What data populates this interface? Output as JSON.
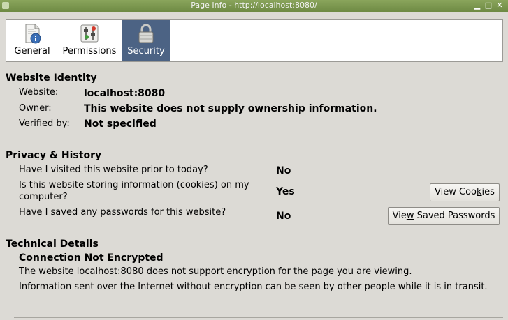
{
  "window": {
    "title": "Page Info - http://localhost:8080/",
    "min_symbol": "▁",
    "max_symbol": "□",
    "close_symbol": "✕"
  },
  "tabs": [
    {
      "label": "General",
      "icon": "page-info-icon",
      "selected": false
    },
    {
      "label": "Permissions",
      "icon": "permissions-icon",
      "selected": false
    },
    {
      "label": "Security",
      "icon": "padlock-icon",
      "selected": true
    }
  ],
  "identity": {
    "heading": "Website Identity",
    "website_label": "Website:",
    "website_value": "localhost:8080",
    "owner_label": "Owner:",
    "owner_value": "This website does not supply ownership information.",
    "verified_label": "Verified by:",
    "verified_value": "Not specified"
  },
  "privacy": {
    "heading": "Privacy & History",
    "q1": "Have I visited this website prior to today?",
    "a1": "No",
    "q2_line1": "Is this website storing information (cookies) on my",
    "q2_line2": "computer?",
    "a2": "Yes",
    "q3": "Have I saved any passwords for this website?",
    "a3": "No",
    "view_cookies_pre": "View Coo",
    "view_cookies_u": "k",
    "view_cookies_post": "ies",
    "view_passwords_pre": "Vie",
    "view_passwords_u": "w",
    "view_passwords_post": " Saved Passwords"
  },
  "technical": {
    "heading": "Technical Details",
    "status": "Connection Not Encrypted",
    "line1": "The website localhost:8080 does not support encryption for the page you are viewing.",
    "line2": "Information sent over the Internet without encryption can be seen by other people while it is in transit."
  },
  "colors": {
    "titlebar": "#7a9850",
    "tab_selected": "#4c6384",
    "background": "#dcdad5"
  }
}
